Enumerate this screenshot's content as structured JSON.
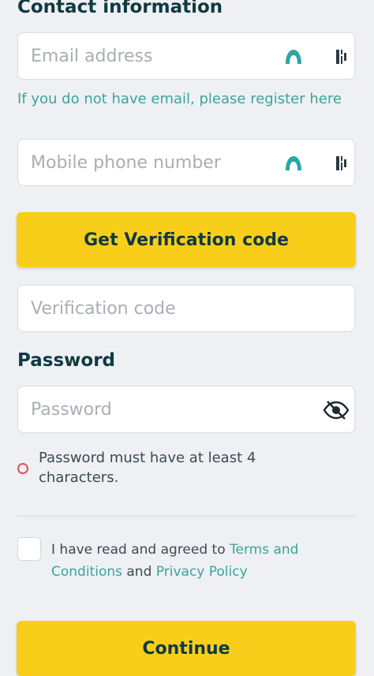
{
  "contact": {
    "heading": "Contact information",
    "email_placeholder": "Email address",
    "register_link": "If you do not have email, please register here",
    "phone_placeholder": "Mobile phone number",
    "get_code_label": "Get Verification code",
    "code_placeholder": "Verification code"
  },
  "password": {
    "heading": "Password",
    "placeholder": "Password",
    "hint": "Password must have at least 4 characters."
  },
  "agreement": {
    "prefix": "I have read and agreed to ",
    "terms_link": "Terms and Conditions",
    "middle": " and ",
    "privacy_link": "Privacy Policy"
  },
  "continue_label": "Continue",
  "colors": {
    "accent_yellow": "#f9ce1b",
    "link_teal": "#3aa59b",
    "heading_dark": "#0f3a40",
    "error_red": "#d9535f"
  }
}
